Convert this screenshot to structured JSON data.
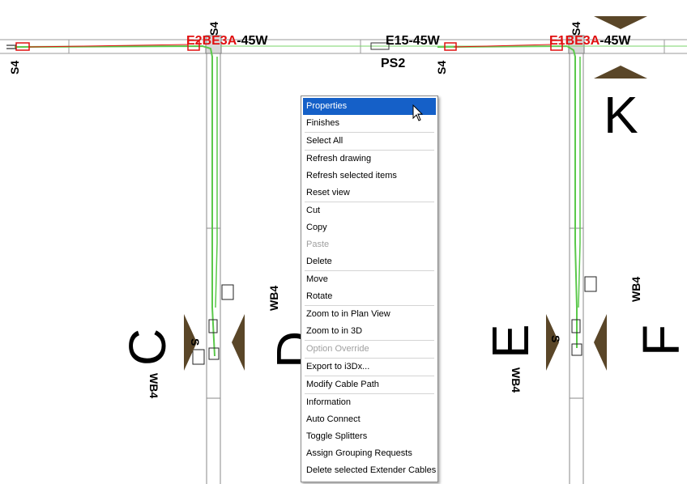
{
  "drawing": {
    "labels_top": {
      "left_col": "S4",
      "left_tag_a": "E2B",
      "left_tag_b": "E3A",
      "left_tag_rest": "-45W",
      "mid_tag": "E15-45W",
      "ps2": "PS2",
      "right_col": "S4",
      "right_tag_a": "E1B",
      "right_tag_b": "E3A",
      "right_tag_rest": "-45W",
      "s4_far_left": "S4",
      "s4_mid": "S4"
    },
    "grid_letters": {
      "k": "K",
      "c": "C",
      "d": "D",
      "e": "E",
      "f": "F"
    },
    "wb_labels": {
      "wb_left": "WB4",
      "wb_mid": "WB4",
      "wb_right_low": "WB4",
      "wb_right": "WB4"
    },
    "s_fragment_left": "S",
    "s_fragment_right": "S"
  },
  "context_menu": {
    "groups": [
      [
        {
          "label": "Properties",
          "state": "selected"
        },
        {
          "label": "Finishes",
          "state": "normal"
        }
      ],
      [
        {
          "label": "Select All",
          "state": "normal"
        }
      ],
      [
        {
          "label": "Refresh drawing",
          "state": "normal"
        },
        {
          "label": "Refresh selected items",
          "state": "normal"
        },
        {
          "label": "Reset view",
          "state": "normal"
        }
      ],
      [
        {
          "label": "Cut",
          "state": "normal"
        },
        {
          "label": "Copy",
          "state": "normal"
        },
        {
          "label": "Paste",
          "state": "disabled"
        },
        {
          "label": "Delete",
          "state": "normal"
        }
      ],
      [
        {
          "label": "Move",
          "state": "normal"
        },
        {
          "label": "Rotate",
          "state": "normal"
        }
      ],
      [
        {
          "label": "Zoom to in Plan View",
          "state": "normal"
        },
        {
          "label": "Zoom to in 3D",
          "state": "normal"
        }
      ],
      [
        {
          "label": "Option Override",
          "state": "disabled"
        }
      ],
      [
        {
          "label": "Export to i3Dx...",
          "state": "normal"
        }
      ],
      [
        {
          "label": "Modify Cable Path",
          "state": "normal"
        }
      ],
      [
        {
          "label": "Information",
          "state": "normal"
        },
        {
          "label": "Auto Connect",
          "state": "normal"
        },
        {
          "label": "Toggle Splitters",
          "state": "normal"
        },
        {
          "label": "Assign Grouping Requests",
          "state": "normal"
        },
        {
          "label": "Delete selected Extender Cables",
          "state": "normal"
        }
      ]
    ]
  },
  "colors": {
    "selection": "#1560c8",
    "cable": "#5ac84a",
    "tag_red": "#e01010",
    "marker": "#5a4628"
  }
}
